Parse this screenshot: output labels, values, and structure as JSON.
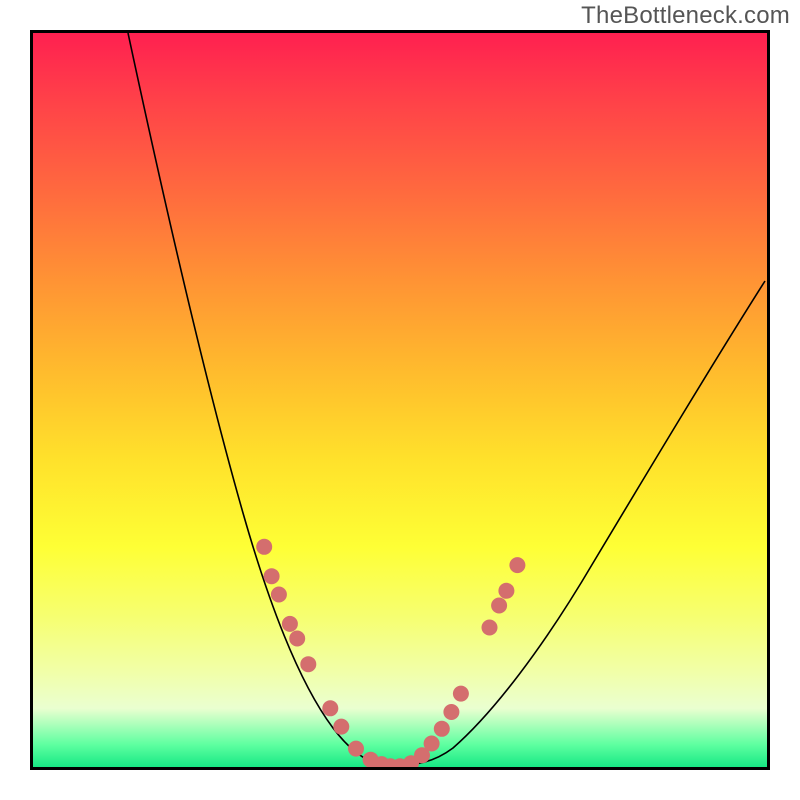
{
  "watermark": "TheBottleneck.com",
  "chart_data": {
    "type": "line",
    "title": "",
    "xlabel": "",
    "ylabel": "",
    "xlim": [
      0,
      100
    ],
    "ylim": [
      0,
      100
    ],
    "grid": false,
    "note": "No axis ticks or numeric labels are rendered in the image; values below are estimated proportional positions (0–100) read off the plot.",
    "series": [
      {
        "name": "left-curve",
        "x": [
          13,
          18,
          23,
          29,
          35,
          41,
          45,
          48.5
        ],
        "y": [
          100,
          80,
          60,
          40,
          22,
          10,
          3,
          0
        ]
      },
      {
        "name": "right-curve",
        "x": [
          100,
          90,
          80,
          72,
          64,
          57,
          53,
          49.7
        ],
        "y": [
          66,
          52,
          38,
          26,
          15,
          6,
          1.5,
          0
        ]
      }
    ],
    "points_left": [
      {
        "x": 31.5,
        "y": 30
      },
      {
        "x": 32.5,
        "y": 26
      },
      {
        "x": 33.5,
        "y": 23.5
      },
      {
        "x": 35.0,
        "y": 19.5
      },
      {
        "x": 36.0,
        "y": 17.5
      },
      {
        "x": 37.5,
        "y": 14
      },
      {
        "x": 40.5,
        "y": 8
      },
      {
        "x": 42.0,
        "y": 5.5
      },
      {
        "x": 44.0,
        "y": 2.5
      },
      {
        "x": 46.0,
        "y": 1
      },
      {
        "x": 47.5,
        "y": 0.4
      },
      {
        "x": 48.7,
        "y": 0.1
      },
      {
        "x": 50.0,
        "y": 0.1
      }
    ],
    "points_right": [
      {
        "x": 51.5,
        "y": 0.5
      },
      {
        "x": 53.0,
        "y": 1.6
      },
      {
        "x": 54.3,
        "y": 3.2
      },
      {
        "x": 55.7,
        "y": 5.2
      },
      {
        "x": 57.0,
        "y": 7.5
      },
      {
        "x": 58.3,
        "y": 10.0
      },
      {
        "x": 62.2,
        "y": 19.0
      },
      {
        "x": 63.5,
        "y": 22.0
      },
      {
        "x": 64.5,
        "y": 24.0
      },
      {
        "x": 66.0,
        "y": 27.5
      }
    ],
    "point_color": "#d46e6e",
    "gradient_top": "#ff2050",
    "gradient_bottom": "#17e884"
  }
}
